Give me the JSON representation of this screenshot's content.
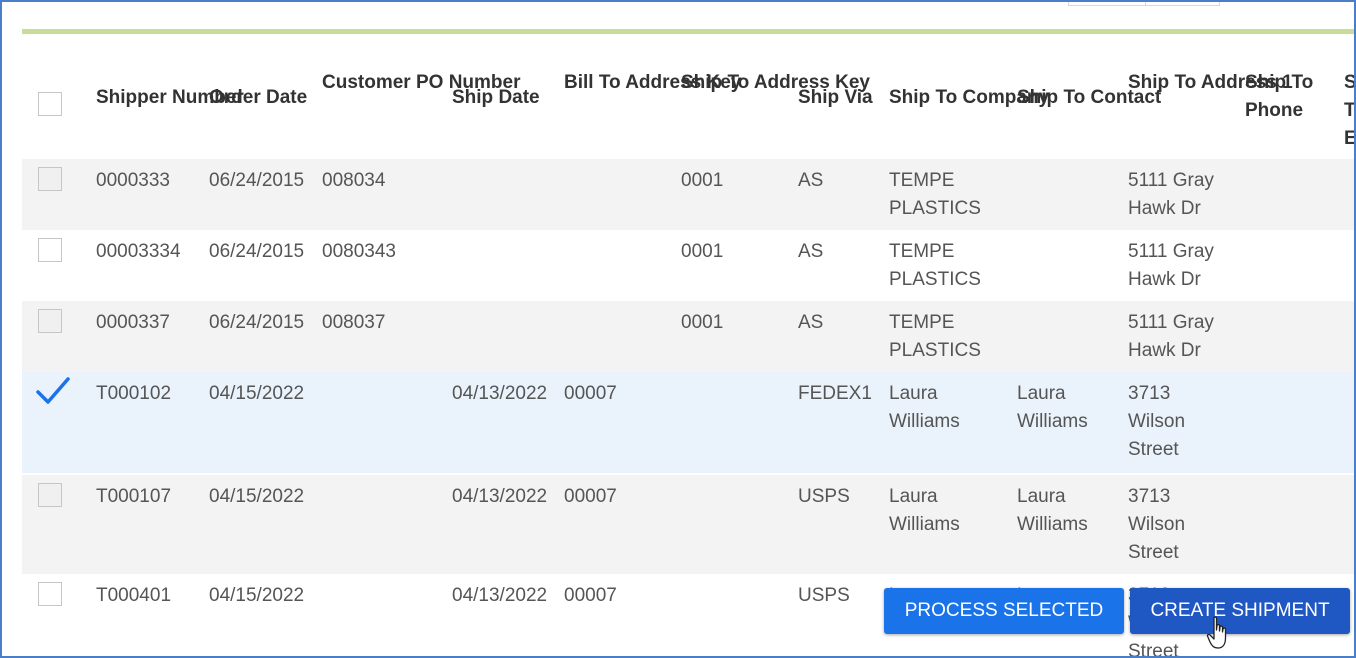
{
  "headers": {
    "shipper_number": "Shipper\nNumber",
    "order_date": "Order\nDate",
    "customer_po": "Customer\nPO\nNumber",
    "ship_date": "Ship\nDate",
    "bill_to": "Bill To\nAddress\nKey",
    "ship_to_key": "Ship To\nAddress\nKey",
    "ship_via": "Ship\nVia",
    "ship_to_company": "Ship To\nCompany",
    "ship_to_contact": "Ship To\nContact",
    "ship_to_address1": "Ship To\nAddress\n1",
    "ship_to_phone": "Ship\nTo\nPhone",
    "cut_off": "S\nT\nE"
  },
  "rows": [
    {
      "shipper": "0000333",
      "order_date": "06/24/2015",
      "po": "008034",
      "ship_date": "",
      "bill_to": "",
      "ship_to_key": "0001",
      "via": "AS",
      "company": "TEMPE\nPLASTICS",
      "contact": "",
      "address1": "5111 Gray\nHawk Dr",
      "checked": false
    },
    {
      "shipper": "00003334",
      "order_date": "06/24/2015",
      "po": "0080343",
      "ship_date": "",
      "bill_to": "",
      "ship_to_key": "0001",
      "via": "AS",
      "company": "TEMPE\nPLASTICS",
      "contact": "",
      "address1": "5111 Gray\nHawk Dr",
      "checked": false
    },
    {
      "shipper": "0000337",
      "order_date": "06/24/2015",
      "po": "008037",
      "ship_date": "",
      "bill_to": "",
      "ship_to_key": "0001",
      "via": "AS",
      "company": "TEMPE\nPLASTICS",
      "contact": "",
      "address1": "5111 Gray\nHawk Dr",
      "checked": false
    },
    {
      "shipper": "T000102",
      "order_date": "04/15/2022",
      "po": "",
      "ship_date": "04/13/2022",
      "bill_to": "00007",
      "ship_to_key": "",
      "via": "FEDEX1",
      "company": "Laura\nWilliams",
      "contact": "Laura\nWilliams",
      "address1": "3713\nWilson\nStreet",
      "checked": true
    },
    {
      "shipper": "T000107",
      "order_date": "04/15/2022",
      "po": "",
      "ship_date": "04/13/2022",
      "bill_to": "00007",
      "ship_to_key": "",
      "via": "USPS",
      "company": "Laura\nWilliams",
      "contact": "Laura\nWilliams",
      "address1": "3713\nWilson\nStreet",
      "checked": false
    },
    {
      "shipper": "T000401",
      "order_date": "04/15/2022",
      "po": "",
      "ship_date": "04/13/2022",
      "bill_to": "00007",
      "ship_to_key": "",
      "via": "USPS",
      "company": "L",
      "contact": "L",
      "address1": "3713\nWilson\nStreet",
      "checked": false
    }
  ],
  "buttons": {
    "process_selected": "PROCESS SELECTED",
    "create_shipment": "CREATE SHIPMENT"
  },
  "colors": {
    "accent_green": "#c8dc9c",
    "checkmark": "#1a73e8",
    "button_primary": "#1a73e8",
    "button_dark": "#1f57c3"
  }
}
